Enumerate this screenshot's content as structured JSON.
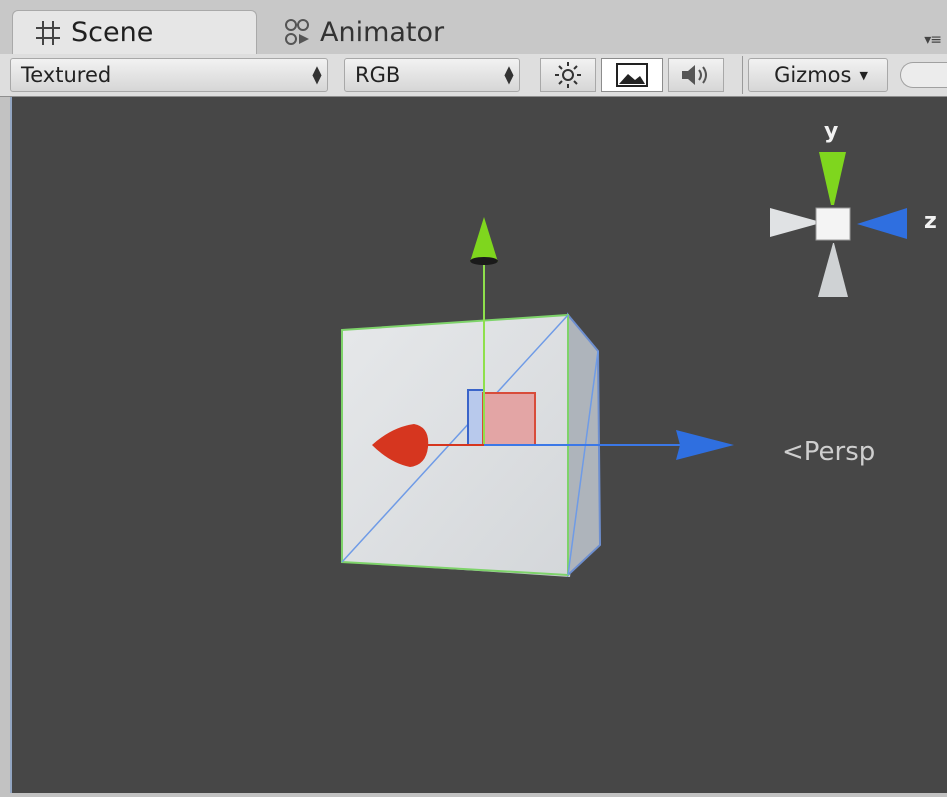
{
  "tabs": [
    {
      "label": "Scene",
      "icon": "grid-icon",
      "active": true
    },
    {
      "label": "Animator",
      "icon": "animator-icon",
      "active": false
    }
  ],
  "toolbar": {
    "draw_mode": "Textured",
    "render_mode": "RGB",
    "gizmos_label": "Gizmos",
    "buttons": [
      "lighting-icon",
      "image-effects-icon",
      "audio-icon"
    ]
  },
  "scene_gizmo": {
    "y_label": "y",
    "z_label": "z",
    "projection_label": "Persp"
  },
  "colors": {
    "x_axis": "#d6361f",
    "y_axis": "#7fd61e",
    "z_axis": "#2f6fe0",
    "background": "#474747"
  }
}
